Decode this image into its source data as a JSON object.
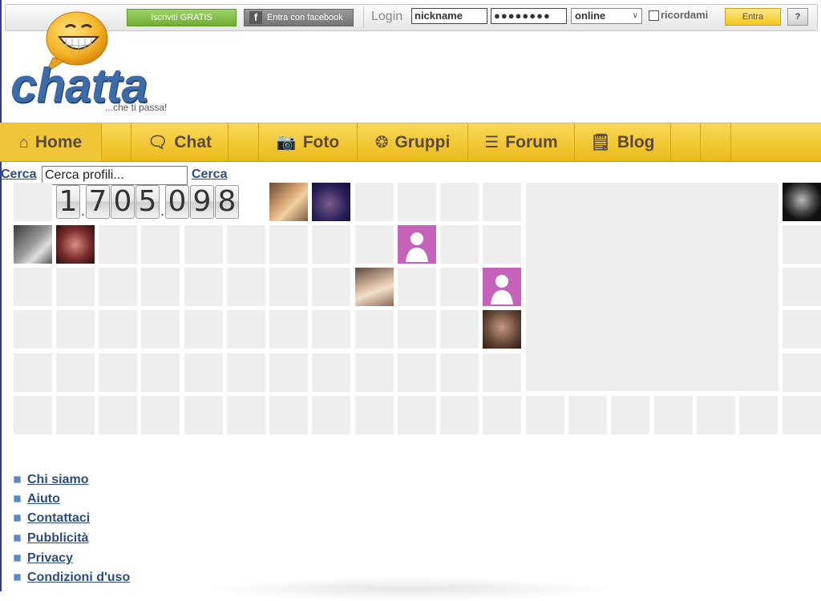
{
  "topbar": {
    "register_label": "Iscriviti GRATIS",
    "facebook_label": "Entra con facebook",
    "login_label": "Login",
    "nickname_value": "nickname",
    "password_value": "●●●●●●●●",
    "status_value": "online",
    "remember_label": "ricordami",
    "enter_label": "Entra",
    "help_label": "?"
  },
  "logo": {
    "name": "chatta",
    "tagline": "...che ti passa!"
  },
  "nav": {
    "home": "Home",
    "chat": "Chat",
    "photo": "Foto",
    "groups": "Gruppi",
    "forum": "Forum",
    "blog": "Blog"
  },
  "search": {
    "label": "Cerca",
    "placeholder": "Cerca profili...",
    "value": "Cerca profili...",
    "button": "Cerca"
  },
  "counter": {
    "digits": [
      "1",
      ".",
      "7",
      "0",
      "5",
      ".",
      "0",
      "9",
      "8"
    ]
  },
  "footer": {
    "links": [
      "Chi siamo",
      "Aiuto",
      "Contattaci",
      "Pubblicità",
      "Privacy",
      "Condizioni d'uso"
    ]
  },
  "colors": {
    "nav_yellow": "#f1c62b",
    "link_blue": "#2d4d7e",
    "placeholder_pink": "#c463b9",
    "tile_gray": "#eeeeee"
  }
}
